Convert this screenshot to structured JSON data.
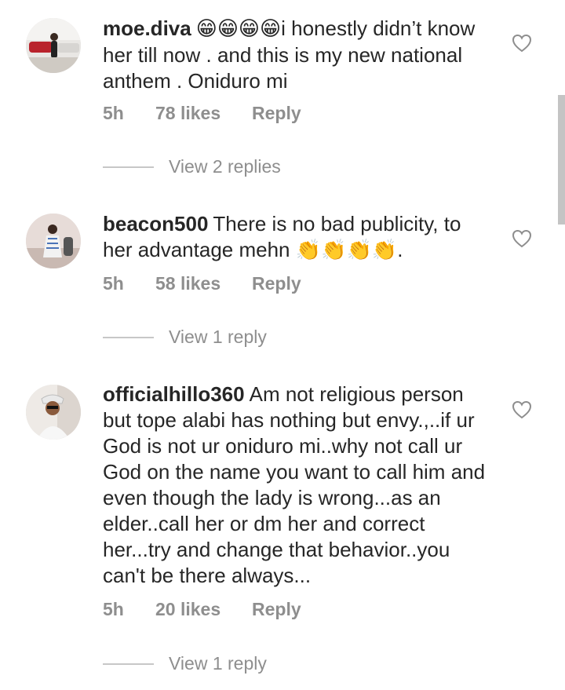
{
  "comments": [
    {
      "username": "moe.diva",
      "emoji": "😁😁😁😁",
      "text": "i honestly didn’t know her till now . and this is my new national anthem . Oniduro mi",
      "time": "5h",
      "likes": "78 likes",
      "reply_label": "Reply",
      "view_replies": "View 2 replies"
    },
    {
      "username": "beacon500",
      "text": "There is no bad publicity, to her advantage mehn",
      "emoji": "👏👏👏👏",
      "trail": ".",
      "time": "5h",
      "likes": "58 likes",
      "reply_label": "Reply",
      "view_replies": "View 1 reply"
    },
    {
      "username": "officialhillo360",
      "text": "Am not religious person but tope alabi has nothing but envy.,..if ur God  is not ur oniduro mi..why not call ur God on the name you want to call him and even though the lady is wrong...as an elder..call her or dm her and correct her...try and change that behavior..you can't be there always...",
      "time": "5h",
      "likes": "20 likes",
      "reply_label": "Reply",
      "view_replies": "View 1 reply"
    }
  ],
  "colors": {
    "text": "#262626",
    "secondary": "#8e8e8e",
    "divider": "#c7c7c7"
  },
  "icons": [
    "heart-outline-icon",
    "avatar"
  ]
}
